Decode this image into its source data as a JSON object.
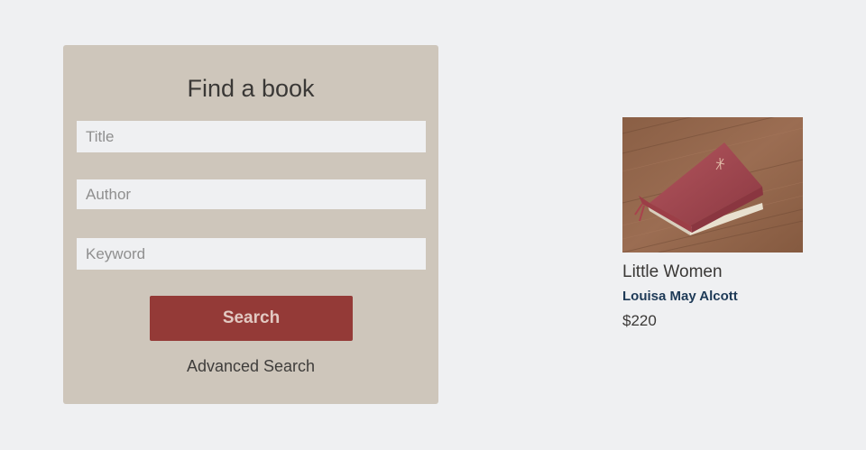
{
  "search_panel": {
    "heading": "Find a book",
    "title_placeholder": "Title",
    "author_placeholder": "Author",
    "keyword_placeholder": "Keyword",
    "search_label": "Search",
    "advanced_label": "Advanced Search"
  },
  "featured_book": {
    "title": "Little Women",
    "author": "Louisa May Alcott",
    "price": "$220",
    "image": "book-cover-photo"
  },
  "colors": {
    "panel_bg": "#cec6bb",
    "button": "#943a37",
    "author_link": "#1e3a57",
    "page_bg": "#eff0f2"
  }
}
